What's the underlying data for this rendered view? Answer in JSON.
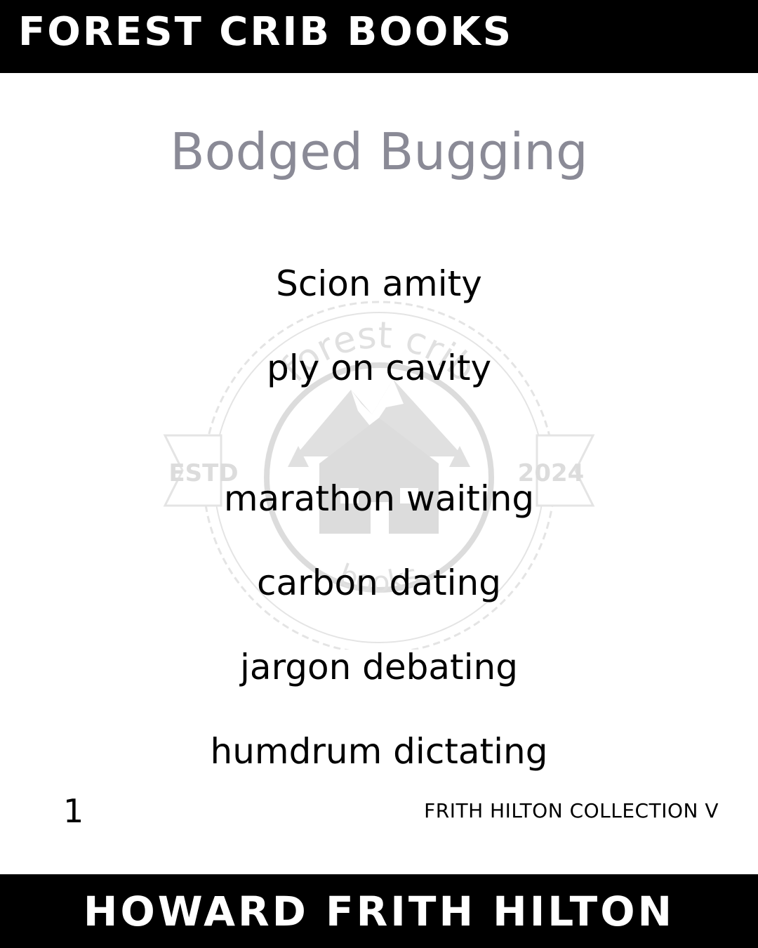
{
  "header": {
    "publisher": "Forest Crib Books"
  },
  "watermark": {
    "top_text": "forest crib",
    "left_text": "ESTD",
    "right_text": "2024",
    "bottom_text": "books",
    "icon": "mountain-cabin-logo"
  },
  "poem": {
    "title": "Bodged Bugging",
    "lines": [
      "Scion amity",
      "ply on cavity",
      "marathon waiting",
      "carbon dating",
      "jargon debating",
      "humdrum dictating"
    ]
  },
  "footer": {
    "page_number": "1",
    "collection": "Frith Hilton Collection V",
    "author": "Howard Frith Hilton"
  },
  "colors": {
    "bar": "#000000",
    "title": "#8a8a96",
    "text": "#000000"
  }
}
